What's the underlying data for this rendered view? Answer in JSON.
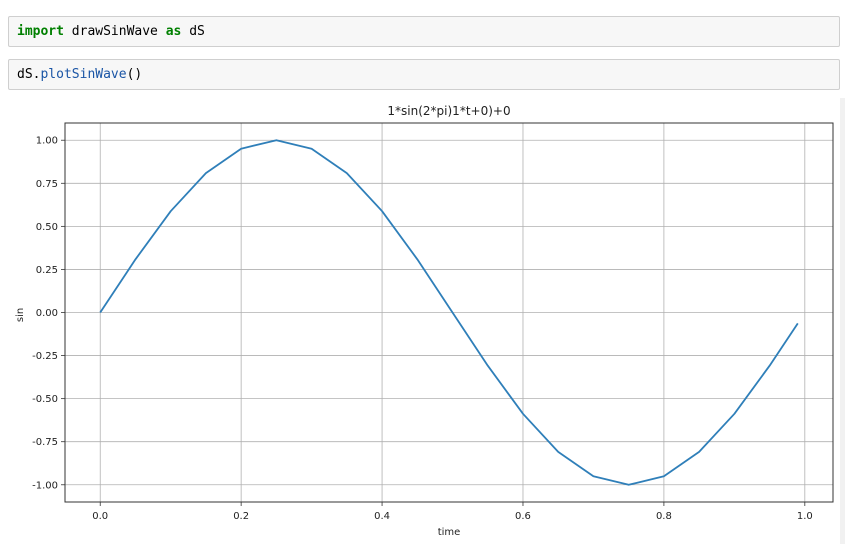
{
  "cells": [
    {
      "tokens": [
        {
          "text": "import",
          "kind": "kw"
        },
        {
          "text": " drawSinWave ",
          "kind": "plain"
        },
        {
          "text": "as",
          "kind": "kw"
        },
        {
          "text": " dS",
          "kind": "plain"
        }
      ]
    },
    {
      "tokens": [
        {
          "text": "dS.",
          "kind": "plain"
        },
        {
          "text": "plotSinWave",
          "kind": "attr"
        },
        {
          "text": "()",
          "kind": "plain"
        }
      ]
    }
  ],
  "chart_data": {
    "type": "line",
    "title": "1*sin(2*pi)1*t+0)+0",
    "xlabel": "time",
    "ylabel": "sin",
    "xlim": [
      -0.05,
      1.04
    ],
    "ylim": [
      -1.1,
      1.1
    ],
    "xticks": [
      0.0,
      0.2,
      0.4,
      0.6,
      0.8,
      1.0
    ],
    "xtick_labels": [
      "0.0",
      "0.2",
      "0.4",
      "0.6",
      "0.8",
      "1.0"
    ],
    "yticks": [
      1.0,
      0.75,
      0.5,
      0.25,
      0.0,
      -0.25,
      -0.5,
      -0.75,
      -1.0
    ],
    "ytick_labels": [
      "1.00",
      "0.75",
      "0.50",
      "0.25",
      "0.00",
      "-0.25",
      "-0.50",
      "-0.75",
      "-1.00"
    ],
    "grid": true,
    "series": [
      {
        "color": "#2f7fb9",
        "x": [
          0.0,
          0.05,
          0.1,
          0.15,
          0.2,
          0.25,
          0.3,
          0.35,
          0.4,
          0.45,
          0.5,
          0.55,
          0.6,
          0.65,
          0.7,
          0.75,
          0.8,
          0.85,
          0.9,
          0.95,
          0.99
        ],
        "y": [
          0.0,
          0.309,
          0.588,
          0.809,
          0.951,
          1.0,
          0.951,
          0.809,
          0.588,
          0.309,
          0.0,
          -0.309,
          -0.588,
          -0.809,
          -0.951,
          -1.0,
          -0.951,
          -0.809,
          -0.588,
          -0.309,
          -0.063
        ]
      }
    ]
  }
}
